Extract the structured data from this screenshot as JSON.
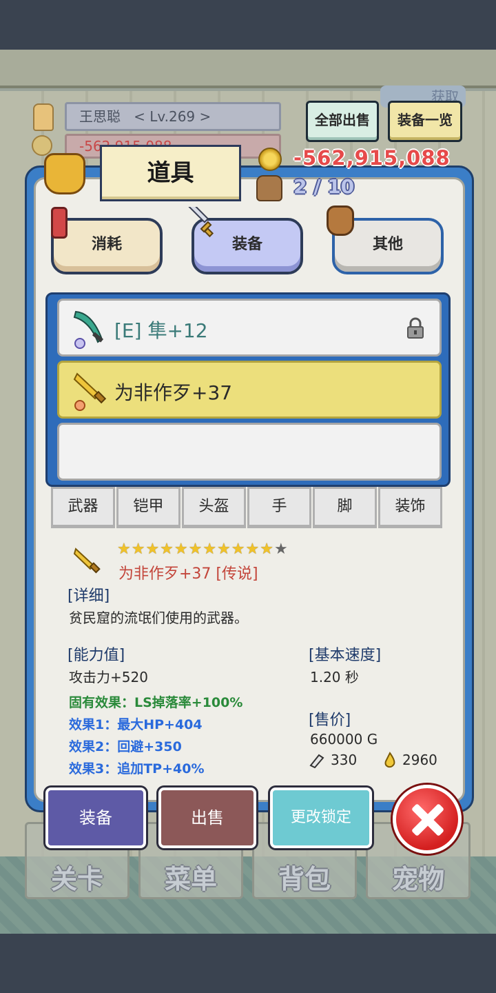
{
  "header": {
    "player_name": "王思聪",
    "player_level": "< Lv.269 >",
    "gold_ghost": "-562,915,088",
    "obtain_badge": "获取",
    "sell_all_label": "全部出售",
    "equip_list_label": "装备一览",
    "gold": "-562,915,088",
    "bag_count": "2 / 10"
  },
  "panel": {
    "title": "道具",
    "tabs": [
      {
        "label": "消耗",
        "icon": "potion-icon"
      },
      {
        "label": "装备",
        "icon": "sword-icon",
        "selected": true
      },
      {
        "label": "其他",
        "icon": "sack-icon"
      }
    ]
  },
  "items": [
    {
      "name": "[E] 隼+12",
      "icon": "scythe-icon",
      "locked": true,
      "selected": false
    },
    {
      "name": "为非作歹+37",
      "icon": "knife-icon",
      "locked": false,
      "selected": true
    },
    {
      "name": "",
      "icon": "",
      "locked": false,
      "selected": false
    }
  ],
  "slot_tabs": [
    "武器",
    "铠甲",
    "头盔",
    "手",
    "脚",
    "装饰"
  ],
  "detail": {
    "stars_filled": 11,
    "stars_total": 12,
    "title": "为非作歹+37 [传说]",
    "detail_head": "[详细]",
    "description": "贫民窟的流氓们使用的武器。",
    "ability_head": "[能力值]",
    "attack": "攻击力+520",
    "fixed_effect": "固有效果：LS掉落率+100%",
    "effect1": "效果1：最大HP+404",
    "effect2": "效果2：回避+350",
    "effect3": "效果3：追加TP+40%",
    "speed_head": "[基本速度]",
    "speed_value": "1.20 秒",
    "price_head": "[售价]",
    "price_value": "660000 G",
    "material1": "330",
    "material2": "2960"
  },
  "actions": {
    "equip": "装备",
    "sell": "出售",
    "change_lock": "更改锁定"
  },
  "nav": [
    "关卡",
    "菜单",
    "背包",
    "宠物"
  ],
  "colors": {
    "panel_blue": "#3b7ec7",
    "selected_row": "#ecdf7c",
    "gold_red": "#e64a4a",
    "legend_red": "#c3453a",
    "effect_green": "#2a8a3a",
    "effect_blue": "#2a6adc"
  }
}
